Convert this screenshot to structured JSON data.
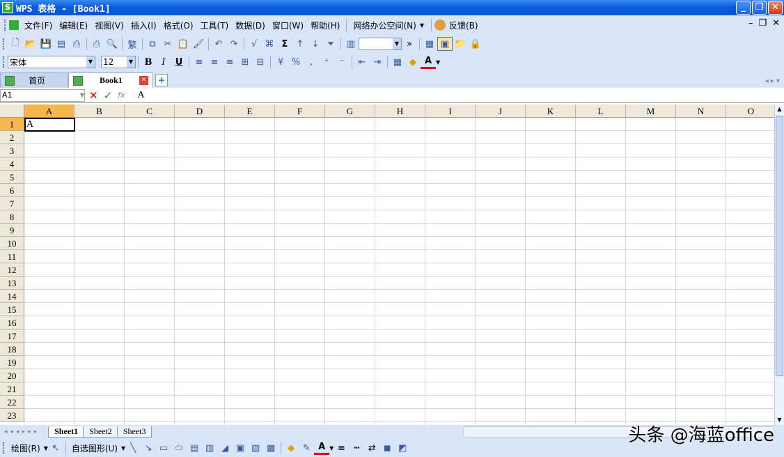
{
  "window": {
    "title": "WPS 表格 - [Book1]",
    "app_icon": "S"
  },
  "menu": [
    "文件(F)",
    "编辑(E)",
    "视图(V)",
    "插入(I)",
    "格式(O)",
    "工具(T)",
    "数据(D)",
    "窗口(W)",
    "帮助(H)",
    "网络办公空间(N)",
    "反馈(B)"
  ],
  "format": {
    "font": "宋体",
    "size": "12",
    "bold": "B",
    "italic": "I",
    "underline": "U",
    "percent": "%"
  },
  "doc_tabs": [
    {
      "label": "首页"
    },
    {
      "label": "Book1"
    }
  ],
  "formula": {
    "name_box": "A1",
    "value": "A",
    "fx": "fx"
  },
  "columns": [
    "A",
    "B",
    "C",
    "D",
    "E",
    "F",
    "G",
    "H",
    "I",
    "J",
    "K",
    "L",
    "M",
    "N",
    "O"
  ],
  "rows": [
    "1",
    "2",
    "3",
    "4",
    "5",
    "6",
    "7",
    "8",
    "9",
    "10",
    "11",
    "12",
    "13",
    "14",
    "15",
    "16",
    "17",
    "18",
    "19",
    "20",
    "21",
    "22",
    "23"
  ],
  "active_cell": {
    "value": "A"
  },
  "sheets": [
    "Sheet1",
    "Sheet2",
    "Sheet3"
  ],
  "draw": {
    "draw_label": "绘图(R)",
    "autoshape_label": "自选图形(U)"
  },
  "watermark": "头条 @海蓝office"
}
